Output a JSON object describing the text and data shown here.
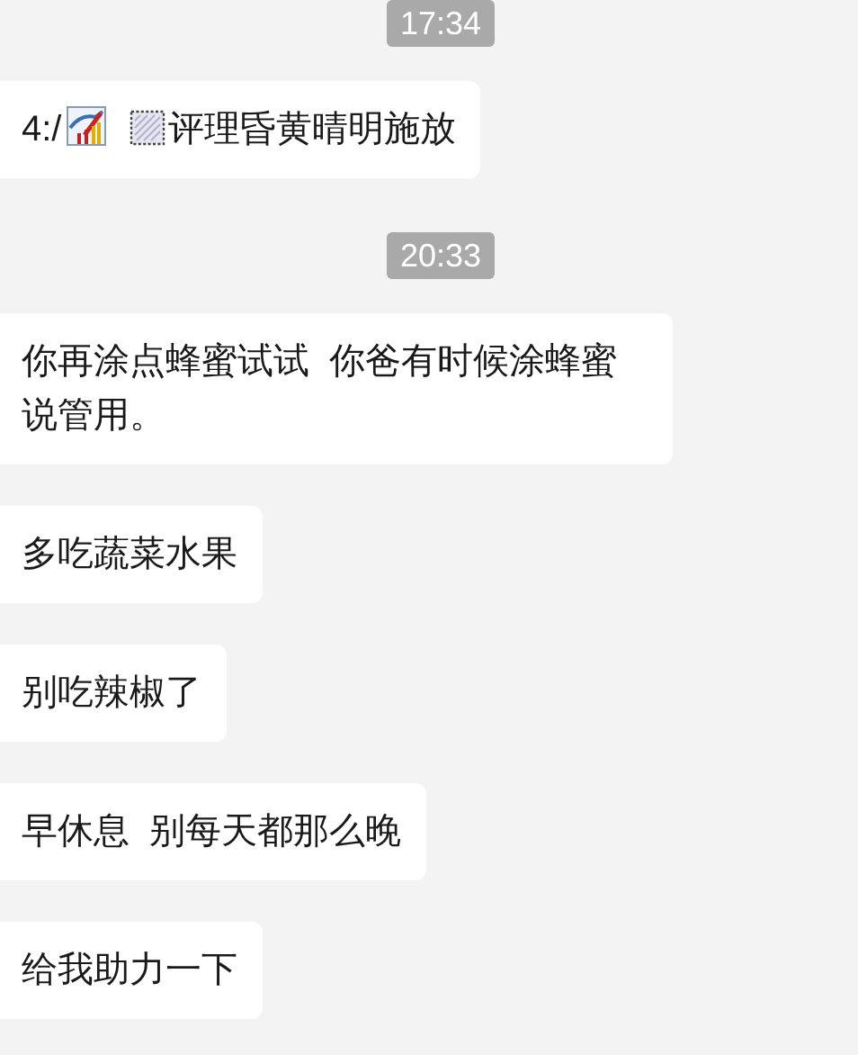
{
  "messages": [
    {
      "kind": "time",
      "text": "17:34"
    },
    {
      "kind": "bubble",
      "parts": [
        {
          "kind": "text",
          "text": "4:/"
        },
        {
          "kind": "chart"
        },
        {
          "kind": "stamp"
        },
        {
          "kind": "text",
          "text": "评理昏黄晴明施放"
        }
      ]
    },
    {
      "kind": "time",
      "text": "20:33"
    },
    {
      "kind": "bubble",
      "parts": [
        {
          "kind": "text",
          "text": "你再涂点蜂蜜试试  你爸有时候涂蜂蜜说管用。"
        }
      ]
    },
    {
      "kind": "bubble",
      "parts": [
        {
          "kind": "text",
          "text": "多吃蔬菜水果"
        }
      ]
    },
    {
      "kind": "bubble",
      "parts": [
        {
          "kind": "text",
          "text": "别吃辣椒了"
        }
      ]
    },
    {
      "kind": "bubble",
      "parts": [
        {
          "kind": "text",
          "text": "早休息  别每天都那么晚"
        }
      ]
    },
    {
      "kind": "bubble",
      "parts": [
        {
          "kind": "text",
          "text": "给我助力一下"
        }
      ]
    }
  ]
}
